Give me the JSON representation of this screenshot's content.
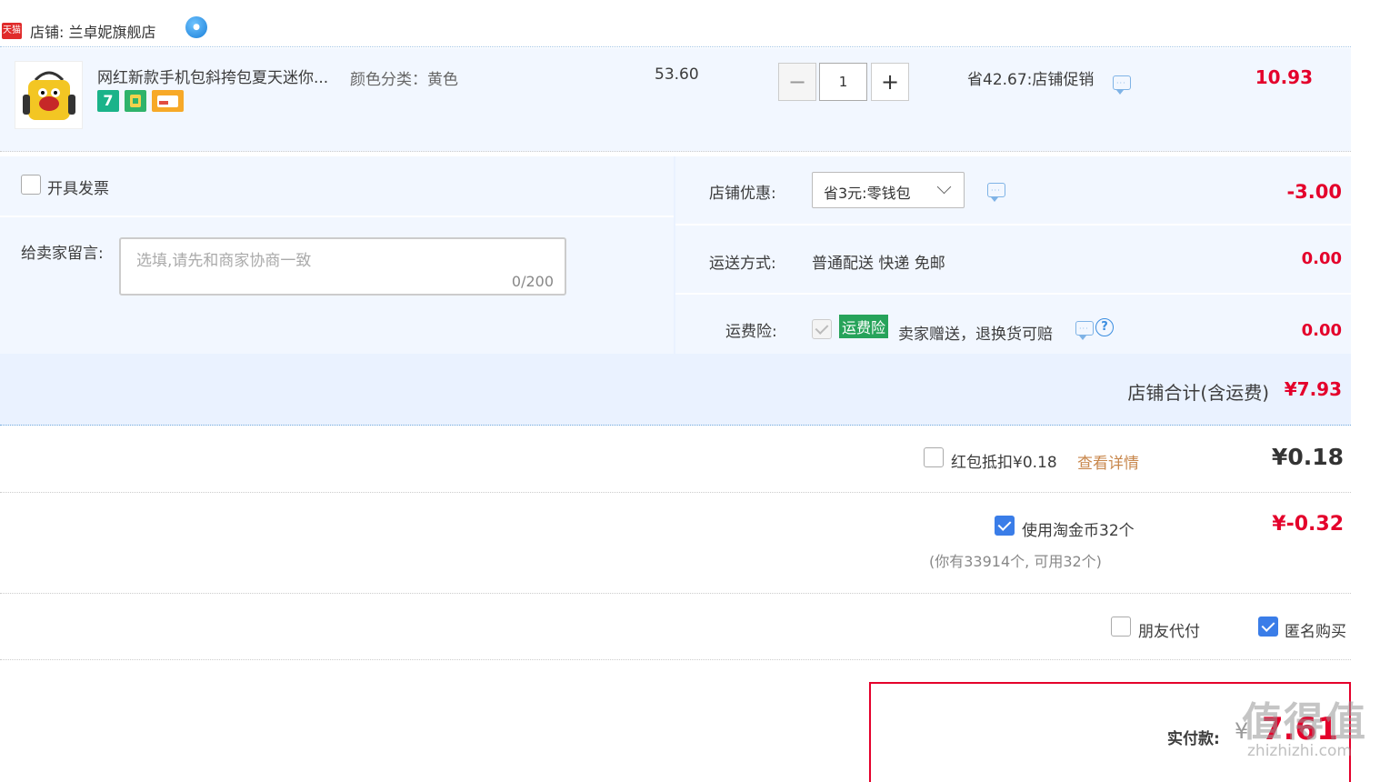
{
  "store": {
    "tmall_logo_text": "天猫",
    "label": "店铺: 兰卓妮旗舰店",
    "wangwang_icon": "chat-bubble-icon"
  },
  "item": {
    "title": "网红新款手机包斜挎包夏天迷你...",
    "sku_label": "颜色分类：黄色",
    "price": "53.60",
    "quantity": "1",
    "minus_label": "−",
    "plus_label": "+",
    "promo": "省42.67:店铺促销",
    "subtotal": "10.93",
    "badges": [
      "seven-day-return-badge",
      "tmall-guarantee-badge",
      "card-payment-badge"
    ],
    "badge_text_7": "7"
  },
  "options": {
    "invoice_label": "开具发票",
    "memo_label": "给卖家留言:",
    "memo_placeholder": "选填,请先和商家协商一致",
    "memo_count": "0/200",
    "coupon_label": "店铺优惠:",
    "coupon_value": "省3元:零钱包",
    "coupon_amount": "-3.00",
    "shipping_label": "运送方式:",
    "shipping_value": "普通配送 快递 免邮",
    "shipping_amount": "0.00",
    "insurance_label": "运费险:",
    "insurance_tag": "运费险",
    "insurance_text": "卖家赠送，退换货可赔",
    "insurance_amount": "0.00",
    "store_total_label": "店铺合计(含运费)",
    "store_total_value": "¥7.93"
  },
  "discounts": {
    "redpack_label": "红包抵扣¥0.18",
    "redpack_link": "查看详情",
    "redpack_amount": "¥0.18",
    "coins_label": "使用淘金币32个",
    "coins_amount": "¥-0.32",
    "coins_note": "(你有33914个, 可用32个)"
  },
  "pay_options": {
    "friend_pay_label": "朋友代付",
    "anonymous_label": "匿名购买"
  },
  "payment": {
    "label": "实付款:",
    "currency": "¥",
    "value": "7.61"
  },
  "watermark": {
    "main": "值得值",
    "sub": "zhizhizhi.com"
  },
  "colors": {
    "accent_red": "#e4002b",
    "panel_blue": "#f2f7ff",
    "checkbox_blue": "#3a7de8",
    "insurance_green": "#27a35a",
    "link_orange": "#c8874c"
  }
}
